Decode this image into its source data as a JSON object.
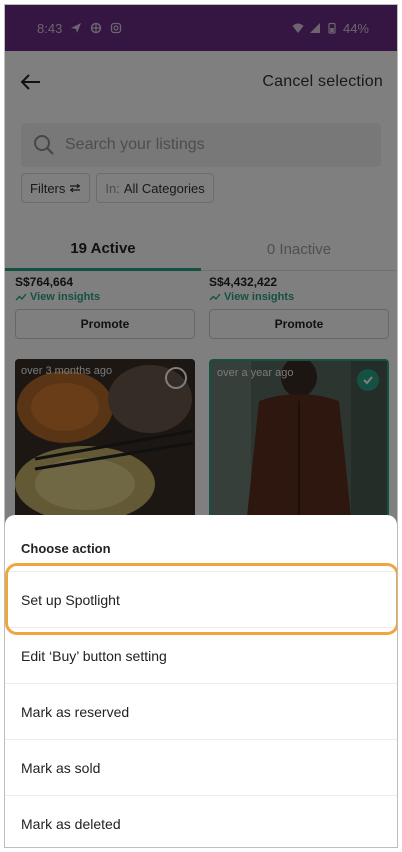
{
  "status_bar": {
    "time": "8:43",
    "battery": "44%"
  },
  "header": {
    "back_icon": "arrow-left-icon",
    "cancel_label": "Cancel selection"
  },
  "search": {
    "placeholder": "Search your listings"
  },
  "filters": {
    "filters_label": "Filters",
    "category_prefix": "In:",
    "category_value": "All Categories"
  },
  "tabs": [
    {
      "label": "19 Active"
    },
    {
      "label": "0 Inactive"
    }
  ],
  "listings": [
    {
      "price": "S$764,664",
      "insights": "View insights",
      "promote": "Promote",
      "age": "over 3 months ago",
      "selected": false
    },
    {
      "price": "S$4,432,422",
      "insights": "View insights",
      "promote": "Promote",
      "age": "over a year ago",
      "selected": true
    }
  ],
  "sheet": {
    "title": "Choose action",
    "actions": [
      {
        "label": "Set up Spotlight"
      },
      {
        "label": "Edit ‘Buy’ button setting"
      },
      {
        "label": "Mark as reserved"
      },
      {
        "label": "Mark as sold"
      },
      {
        "label": "Mark as deleted"
      }
    ]
  },
  "colors": {
    "status_bar": "#6a2a82",
    "accent": "#2aa387",
    "highlight": "#f0a640"
  }
}
